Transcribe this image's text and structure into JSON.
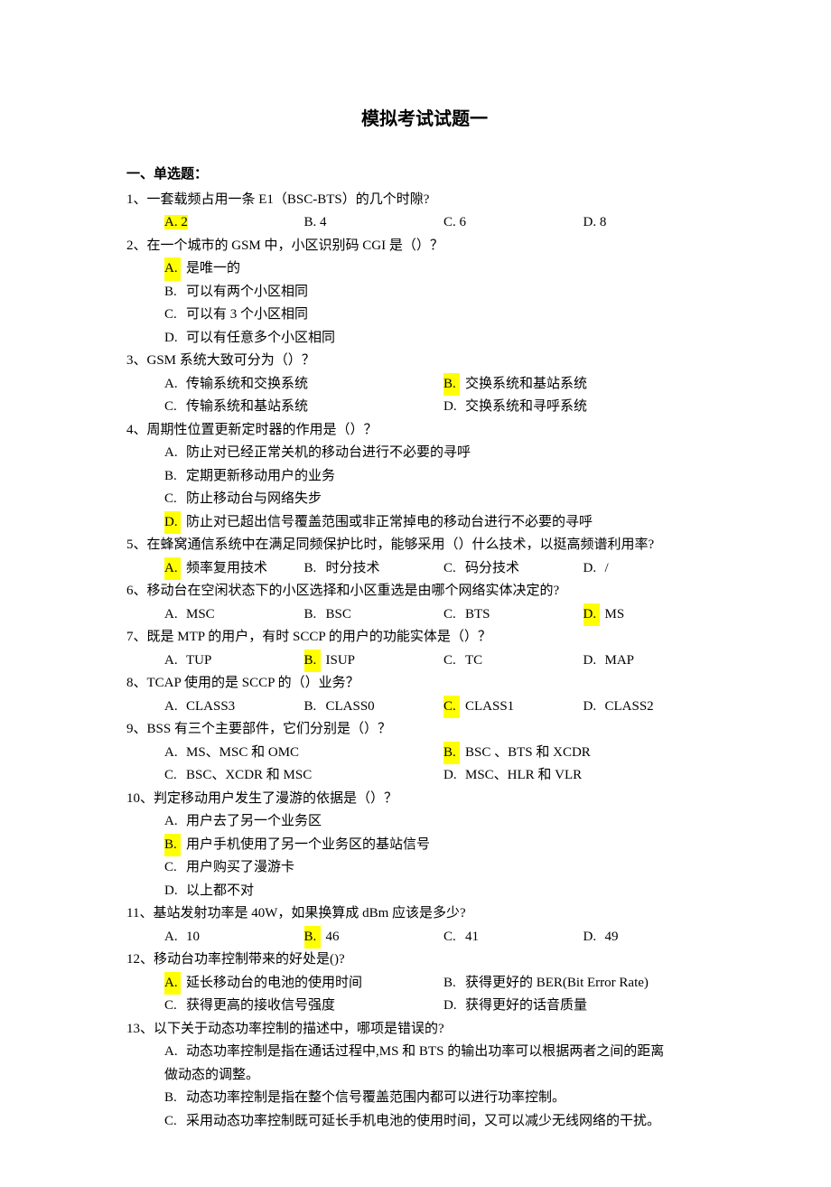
{
  "title": "模拟考试试题一",
  "section_heading": "一、单选题：",
  "q1": {
    "text": "1、一套载频占用一条 E1（BSC-BTS）的几个时隙?",
    "A": "A. 2",
    "B": "B. 4",
    "C": "C. 6",
    "D": "D. 8"
  },
  "q2": {
    "text": "2、在一个城市的 GSM 中，小区识别码 CGI 是（）？",
    "A_l": "A.",
    "A_t": "是唯一的",
    "B_l": "B.",
    "B_t": "可以有两个小区相同",
    "C_l": "C.",
    "C_t": "可以有 3 个小区相同",
    "D_l": "D.",
    "D_t": "可以有任意多个小区相同"
  },
  "q3": {
    "text": "3、GSM 系统大致可分为（）？",
    "A_l": "A.",
    "A_t": "传输系统和交换系统",
    "B_l": "B.",
    "B_t": "交换系统和基站系统",
    "C_l": "C.",
    "C_t": "传输系统和基站系统",
    "D_l": "D.",
    "D_t": "交换系统和寻呼系统"
  },
  "q4": {
    "text": "4、周期性位置更新定时器的作用是（）？",
    "A_l": "A.",
    "A_t": "防止对已经正常关机的移动台进行不必要的寻呼",
    "B_l": "B.",
    "B_t": "定期更新移动用户的业务",
    "C_l": "C.",
    "C_t": "防止移动台与网络失步",
    "D_l": "D.",
    "D_t": "防止对已超出信号覆盖范围或非正常掉电的移动台进行不必要的寻呼"
  },
  "q5": {
    "text": "5、在蜂窝通信系统中在满足同频保护比时，能够采用（）什么技术，以挺高频谱利用率?",
    "A_l": "A.",
    "A_t": "频率复用技术",
    "B_l": "B.",
    "B_t": "时分技术",
    "C_l": "C.",
    "C_t": "码分技术",
    "D_l": "D.",
    "D_t": "/"
  },
  "q6": {
    "text": "6、移动台在空闲状态下的小区选择和小区重选是由哪个网络实体决定的?",
    "A_l": "A.",
    "A_t": "MSC",
    "B_l": "B.",
    "B_t": "BSC",
    "C_l": "C.",
    "C_t": "BTS",
    "D_l": "D.",
    "D_t": "MS"
  },
  "q7": {
    "text": "7、既是 MTP 的用户，有时 SCCP 的用户的功能实体是（）？",
    "A_l": "A.",
    "A_t": "TUP",
    "B_l": "B.",
    "B_t": "ISUP",
    "C_l": "C.",
    "C_t": "TC",
    "D_l": "D.",
    "D_t": "MAP"
  },
  "q8": {
    "text": "8、TCAP 使用的是 SCCP 的（）业务？",
    "A_l": "A.",
    "A_t": "CLASS3",
    "B_l": "B.",
    "B_t": "CLASS0",
    "C_l": "C.",
    "C_t": "CLASS1",
    "D_l": "D.",
    "D_t": "CLASS2"
  },
  "q9": {
    "text": "9、BSS 有三个主要部件，它们分别是（）？",
    "A_l": "A.",
    "A_t": "MS、MSC 和 OMC",
    "B_l": "B.",
    "B_t": "BSC 、BTS 和 XCDR",
    "C_l": "C.",
    "C_t": "BSC、XCDR 和 MSC",
    "D_l": "D.",
    "D_t": "MSC、HLR 和 VLR"
  },
  "q10": {
    "text": "10、判定移动用户发生了漫游的依据是（）？",
    "A_l": "A.",
    "A_t": "用户去了另一个业务区",
    "B_l": "B.",
    "B_t": "用户手机使用了另一个业务区的基站信号",
    "C_l": "C.",
    "C_t": "用户购买了漫游卡",
    "D_l": "D.",
    "D_t": "以上都不对"
  },
  "q11": {
    "text": "11、基站发射功率是 40W，如果换算成 dBm 应该是多少?",
    "A_l": "A.",
    "A_t": "10",
    "B_l": "B.",
    "B_t": "46",
    "C_l": "C.",
    "C_t": "41",
    "D_l": "D.",
    "D_t": "49"
  },
  "q12": {
    "text": "12、移动台功率控制带来的好处是()?",
    "A_l": "A.",
    "A_t": "延长移动台的电池的使用时间",
    "B_l": "B.",
    "B_t": "获得更好的 BER(Bit Error Rate)",
    "C_l": "C.",
    "C_t": "获得更高的接收信号强度",
    "D_l": "D.",
    "D_t": "获得更好的话音质量"
  },
  "q13": {
    "text": "13、以下关于动态功率控制的描述中，哪项是错误的?",
    "A_l": "A.",
    "A_t": "动态功率控制是指在通话过程中,MS 和 BTS 的输出功率可以根据两者之间的距离",
    "A_cont": "做动态的调整。",
    "B_l": "B.",
    "B_t": "动态功率控制是指在整个信号覆盖范围内都可以进行功率控制。",
    "C_l": "C.",
    "C_t": "采用动态功率控制既可延长手机电池的使用时间，又可以减少无线网络的干扰。"
  }
}
